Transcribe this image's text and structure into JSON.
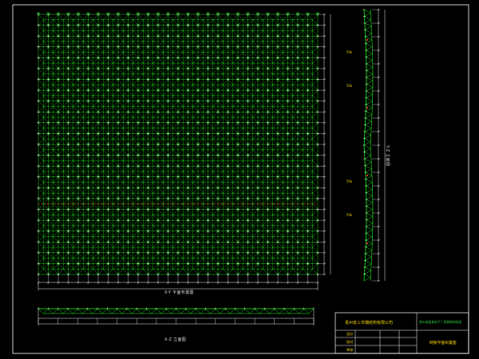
{
  "colors": {
    "background": "#000000",
    "grid_members": "#18f218",
    "grid_nodes": "#ffffff",
    "dimension_lines": "#f0f0f0",
    "red_axis": "#ff2a2a",
    "title_block_text": "#ffd800",
    "title_block_accent": "#2ecc40",
    "frame": "#ffffff"
  },
  "plan_view": {
    "caption": "X-Y 平面布置图",
    "grid_cols": 28,
    "grid_rows": 24
  },
  "elevation_xz": {
    "caption": "X-Z 立面图"
  },
  "elevation_yz": {
    "caption": "Y-Z 立面图",
    "slope_labels": [
      "5%",
      "5%",
      "5%",
      "5%"
    ]
  },
  "title_block": {
    "company": "贵州省三市钢结构有限公司",
    "project": "贵州省某某电子厂房钢结构网架",
    "drawing_title": "网架平面布置图",
    "row_labels": [
      "设计",
      "校对",
      "审核"
    ],
    "row_values": [
      "",
      "",
      ""
    ]
  }
}
